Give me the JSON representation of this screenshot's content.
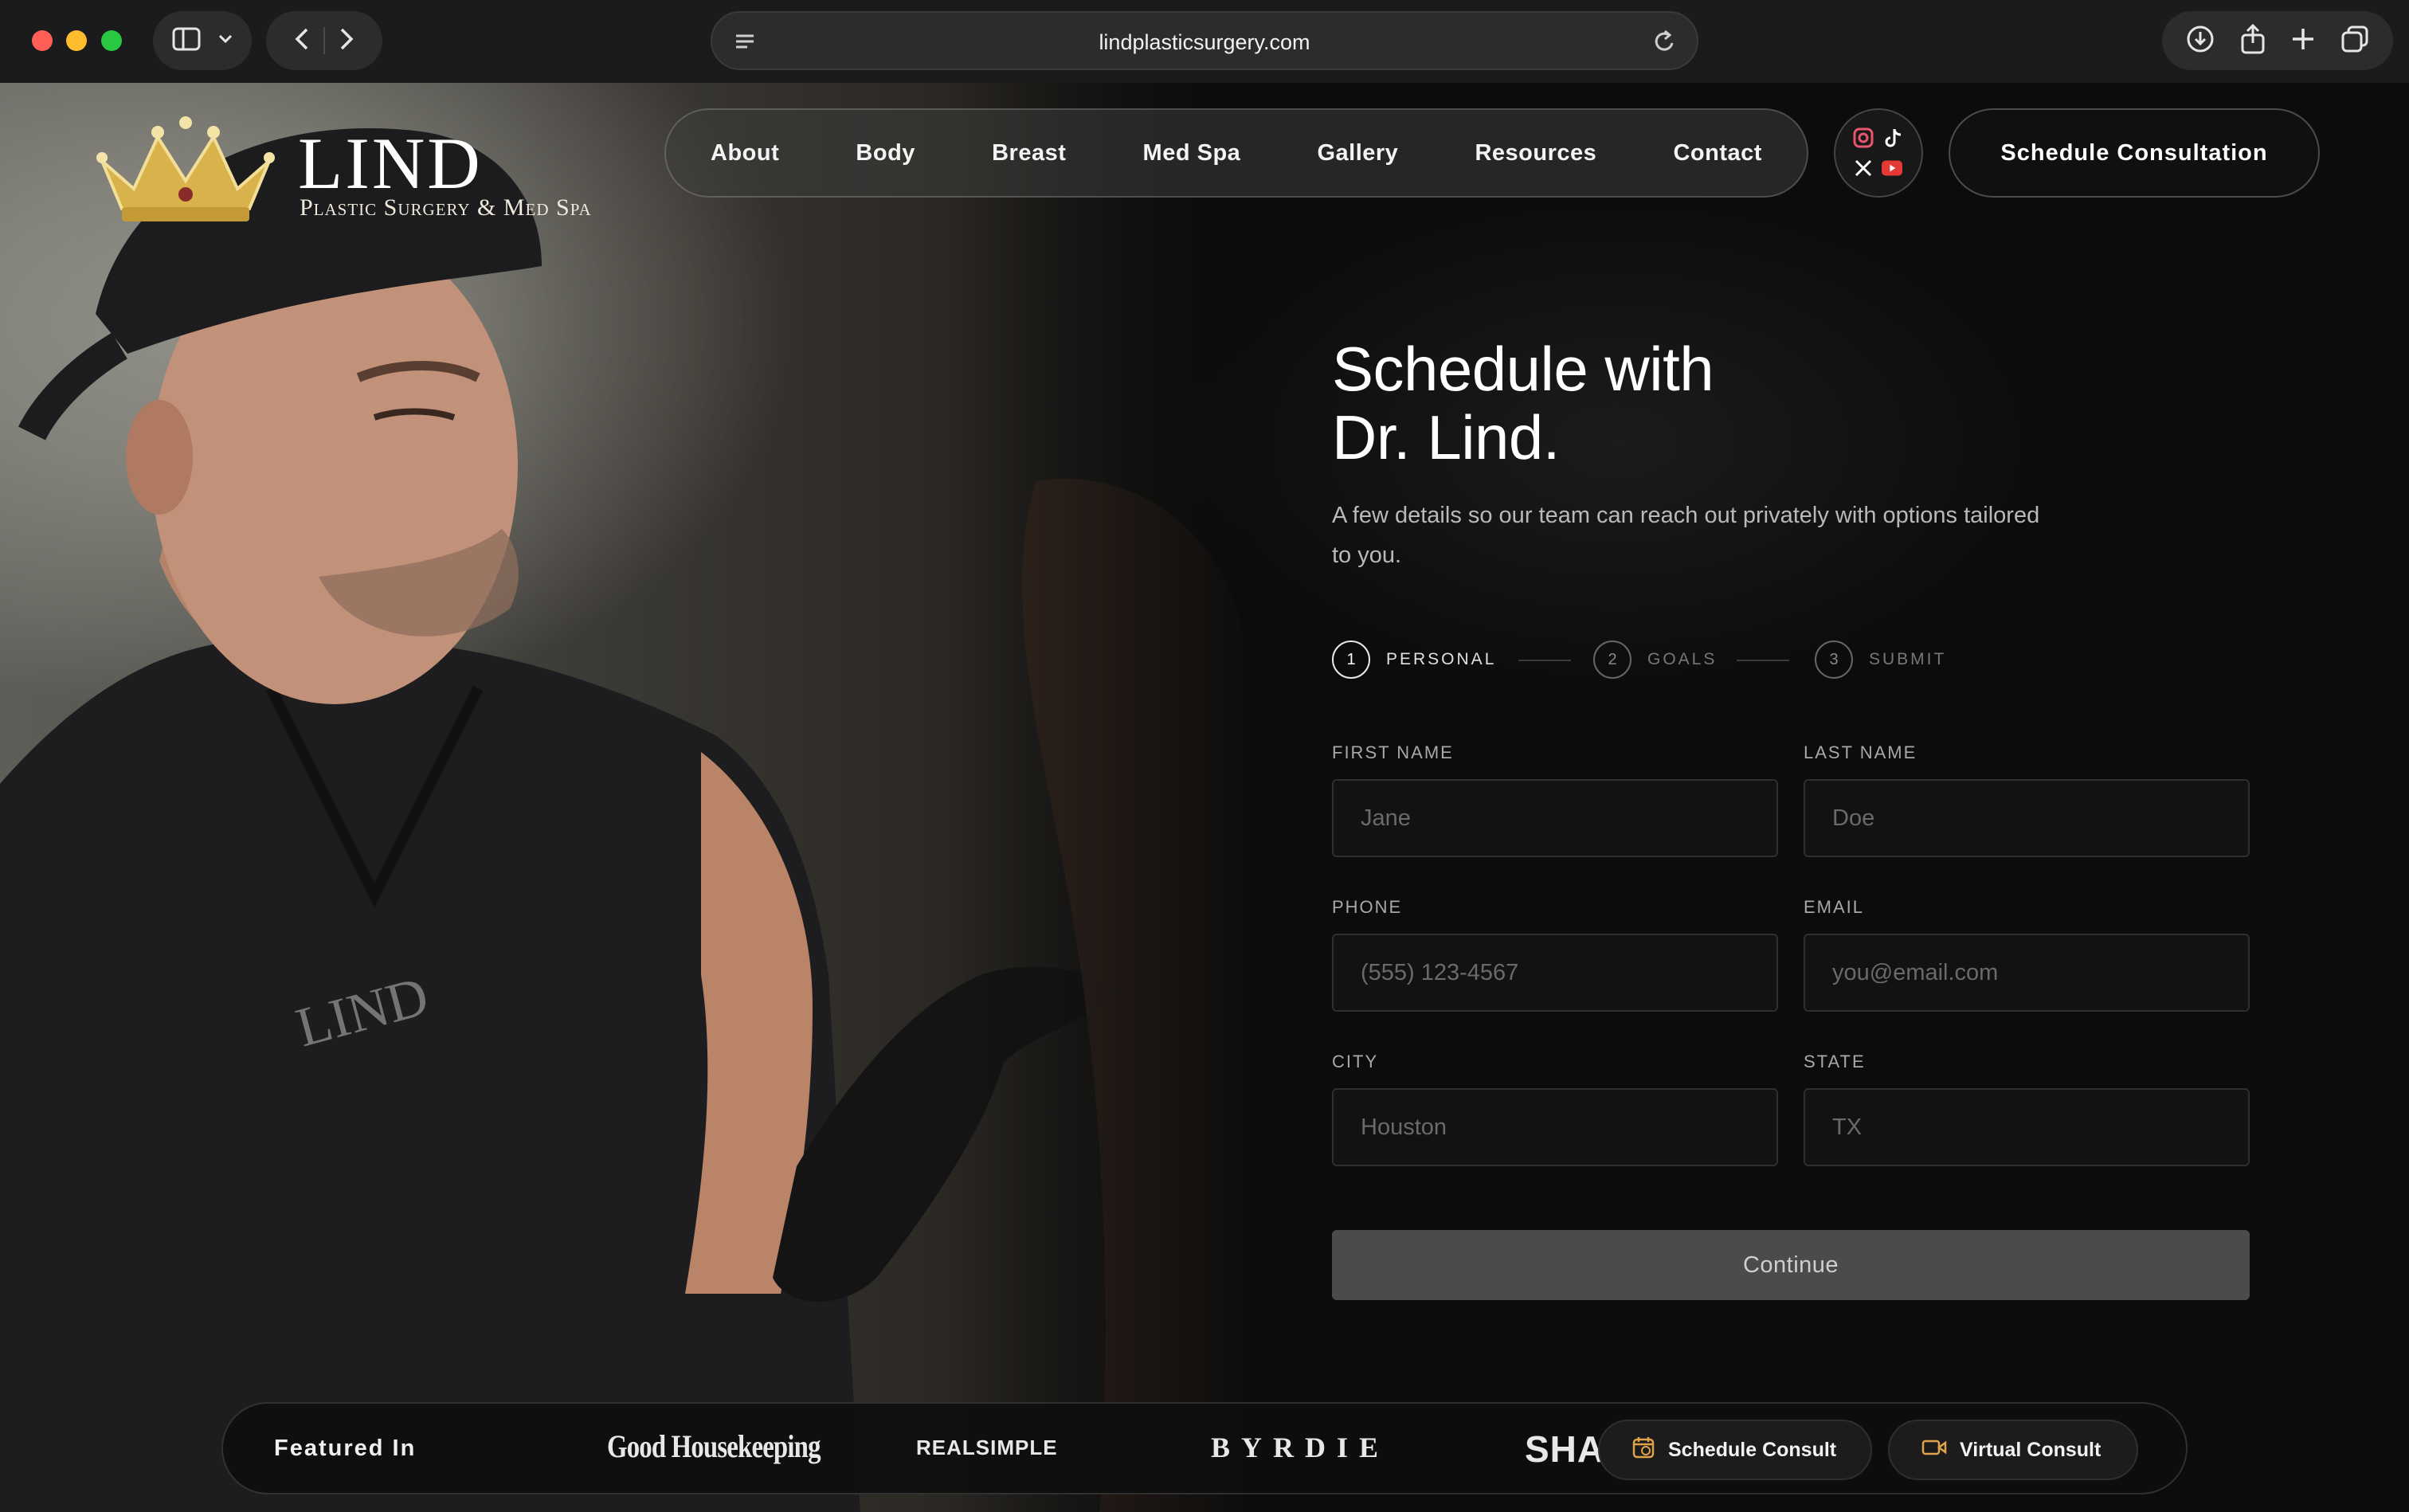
{
  "browser": {
    "url": "lindplasticsurgery.com"
  },
  "logo": {
    "title": "LIND",
    "subtitle": "Plastic Surgery & Med Spa"
  },
  "nav": {
    "items": [
      "About",
      "Body",
      "Breast",
      "Med Spa",
      "Gallery",
      "Resources",
      "Contact"
    ],
    "cta": "Schedule Consultation"
  },
  "form": {
    "title_line1": "Schedule with",
    "title_line2": "Dr. Lind.",
    "description": "A few details so our team can reach out privately with options tailored to you.",
    "steps": [
      {
        "num": "1",
        "label": "PERSONAL"
      },
      {
        "num": "2",
        "label": "GOALS"
      },
      {
        "num": "3",
        "label": "SUBMIT"
      }
    ],
    "fields": {
      "first_name": {
        "label": "FIRST NAME",
        "placeholder": "Jane"
      },
      "last_name": {
        "label": "LAST NAME",
        "placeholder": "Doe"
      },
      "phone": {
        "label": "PHONE",
        "placeholder": "(555) 123-4567"
      },
      "email": {
        "label": "EMAIL",
        "placeholder": "you@email.com"
      },
      "city": {
        "label": "CITY",
        "placeholder": "Houston"
      },
      "state": {
        "label": "STATE",
        "placeholder": "TX"
      }
    },
    "continue_label": "Continue"
  },
  "featured": {
    "label": "Featured In",
    "publications": [
      "Good Housekeeping",
      "REALSIMPLE",
      "BYRDIE",
      "SHA"
    ],
    "schedule_consult": "Schedule Consult",
    "virtual_consult": "Virtual Consult"
  },
  "colors": {
    "background": "#0c0c0c",
    "accent_gold": "#d8b24a"
  }
}
